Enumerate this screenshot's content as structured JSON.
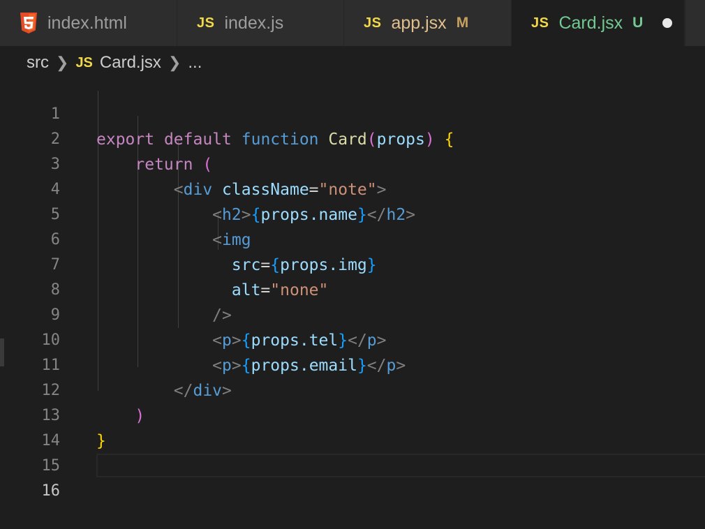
{
  "tabs": [
    {
      "label": "index.html",
      "icon": "html5-icon",
      "badge": "",
      "active": false
    },
    {
      "label": "index.js",
      "icon": "js-icon",
      "badge": "",
      "active": false
    },
    {
      "label": "app.jsx",
      "icon": "js-icon",
      "badge": "M",
      "active": false
    },
    {
      "label": "Card.jsx",
      "icon": "js-icon",
      "badge": "U",
      "active": true
    }
  ],
  "js_icon_text": "JS",
  "breadcrumb": {
    "folder": "src",
    "file": "Card.jsx",
    "more": "..."
  },
  "editor": {
    "current_line": 16,
    "line_numbers": [
      "1",
      "2",
      "3",
      "4",
      "5",
      "6",
      "7",
      "8",
      "9",
      "10",
      "11",
      "12",
      "13",
      "14",
      "15",
      "16"
    ],
    "code": {
      "l1": {
        "kw1": "export",
        "kw2": "default",
        "kw3": "function",
        "name": "Card",
        "open": "(",
        "param": "props",
        "close": ")",
        "brace": "{"
      },
      "l2": {
        "kw": "return",
        "paren": "("
      },
      "l3": {
        "lt": "<",
        "tag": "div",
        "attr": "className",
        "eq": "=",
        "val": "\"note\"",
        "gt": ">"
      },
      "l4": {
        "lt": "<",
        "tag": "h2",
        "gt": ">",
        "ob": "{",
        "expr": "props.name",
        "cb": "}",
        "lt2": "</",
        "tag2": "h2",
        "gt2": ">"
      },
      "l5": {
        "lt": "<",
        "tag": "img"
      },
      "l6": {
        "attr": "src",
        "eq": "=",
        "ob": "{",
        "expr": "props.img",
        "cb": "}"
      },
      "l7": {
        "attr": "alt",
        "eq": "=",
        "val": "\"none\""
      },
      "l8": {
        "close": "/>"
      },
      "l9": {
        "lt": "<",
        "tag": "p",
        "gt": ">",
        "ob": "{",
        "expr": "props.tel",
        "cb": "}",
        "lt2": "</",
        "tag2": "p",
        "gt2": ">"
      },
      "l10": {
        "lt": "<",
        "tag": "p",
        "gt": ">",
        "ob": "{",
        "expr": "props.email",
        "cb": "}",
        "lt2": "</",
        "tag2": "p",
        "gt2": ">"
      },
      "l11": {
        "lt": "</",
        "tag": "div",
        "gt": ">"
      },
      "l12": {
        "paren": ")"
      },
      "l13": {
        "brace": "}"
      }
    }
  },
  "colors": {
    "background": "#1e1e1e",
    "tab_inactive": "#2d2d2d",
    "untracked_green": "#73c991",
    "modified_yellow": "#e2c08d",
    "js_yellow": "#f1d94a",
    "html_orange": "#e44d26"
  }
}
